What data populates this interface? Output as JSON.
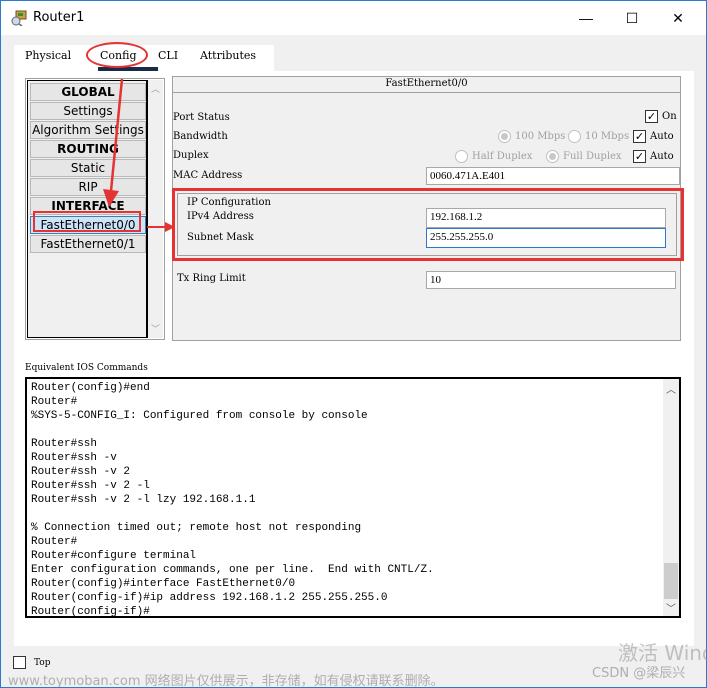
{
  "window": {
    "title": "Router1",
    "app_icon": "router-icon",
    "controls": {
      "minimize": "—",
      "maximize": "☐",
      "close": "✕"
    }
  },
  "tabs": [
    {
      "label": "Physical",
      "active": false
    },
    {
      "label": "Config",
      "active": true
    },
    {
      "label": "CLI",
      "active": false
    },
    {
      "label": "Attributes",
      "active": false
    }
  ],
  "sidebar": {
    "items": [
      {
        "label": "GLOBAL",
        "type": "header"
      },
      {
        "label": "Settings",
        "type": "item"
      },
      {
        "label": "Algorithm Settings",
        "type": "item"
      },
      {
        "label": "ROUTING",
        "type": "header"
      },
      {
        "label": "Static",
        "type": "item"
      },
      {
        "label": "RIP",
        "type": "item"
      },
      {
        "label": "INTERFACE",
        "type": "header"
      },
      {
        "label": "FastEthernet0/0",
        "type": "item",
        "selected": true
      },
      {
        "label": "FastEthernet0/1",
        "type": "item"
      }
    ]
  },
  "interface": {
    "title": "FastEthernet0/0",
    "port_status": {
      "label": "Port Status",
      "on_label": "On",
      "on": true
    },
    "bandwidth": {
      "label": "Bandwidth",
      "options": [
        "100 Mbps",
        "10 Mbps"
      ],
      "selected": "100 Mbps",
      "auto_label": "Auto",
      "auto": true
    },
    "duplex": {
      "label": "Duplex",
      "options": [
        "Half Duplex",
        "Full Duplex"
      ],
      "selected": "Full Duplex",
      "auto_label": "Auto",
      "auto": true
    },
    "mac_address": {
      "label": "MAC Address",
      "value": "0060.471A.E401"
    },
    "ip_configuration": {
      "label": "IP Configuration",
      "ipv4_label": "IPv4 Address",
      "ipv4_value": "192.168.1.2",
      "subnet_label": "Subnet Mask",
      "subnet_value": "255.255.255.0"
    },
    "tx_ring_limit": {
      "label": "Tx Ring Limit",
      "value": "10"
    }
  },
  "ios": {
    "label": "Equivalent IOS Commands",
    "lines": [
      "Router(config)#end",
      "Router#",
      "%SYS-5-CONFIG_I: Configured from console by console",
      "",
      "Router#ssh",
      "Router#ssh -v",
      "Router#ssh -v 2",
      "Router#ssh -v 2 -l",
      "Router#ssh -v 2 -l lzy 192.168.1.1",
      "",
      "% Connection timed out; remote host not responding",
      "Router#",
      "Router#configure terminal",
      "Enter configuration commands, one per line.  End with CNTL/Z.",
      "Router(config)#interface FastEthernet0/0",
      "Router(config-if)#ip address 192.168.1.2 255.255.255.0",
      "Router(config-if)#"
    ]
  },
  "footer": {
    "top_label": "Top",
    "top_checked": false
  },
  "watermarks": {
    "bottom": "www.toymoban.com 网络图片仅供展示，非存储，如有侵权请联系删除。",
    "activate": "激活 Wind",
    "csdn": "CSDN @梁辰兴"
  },
  "annotation_color": "#e53333"
}
